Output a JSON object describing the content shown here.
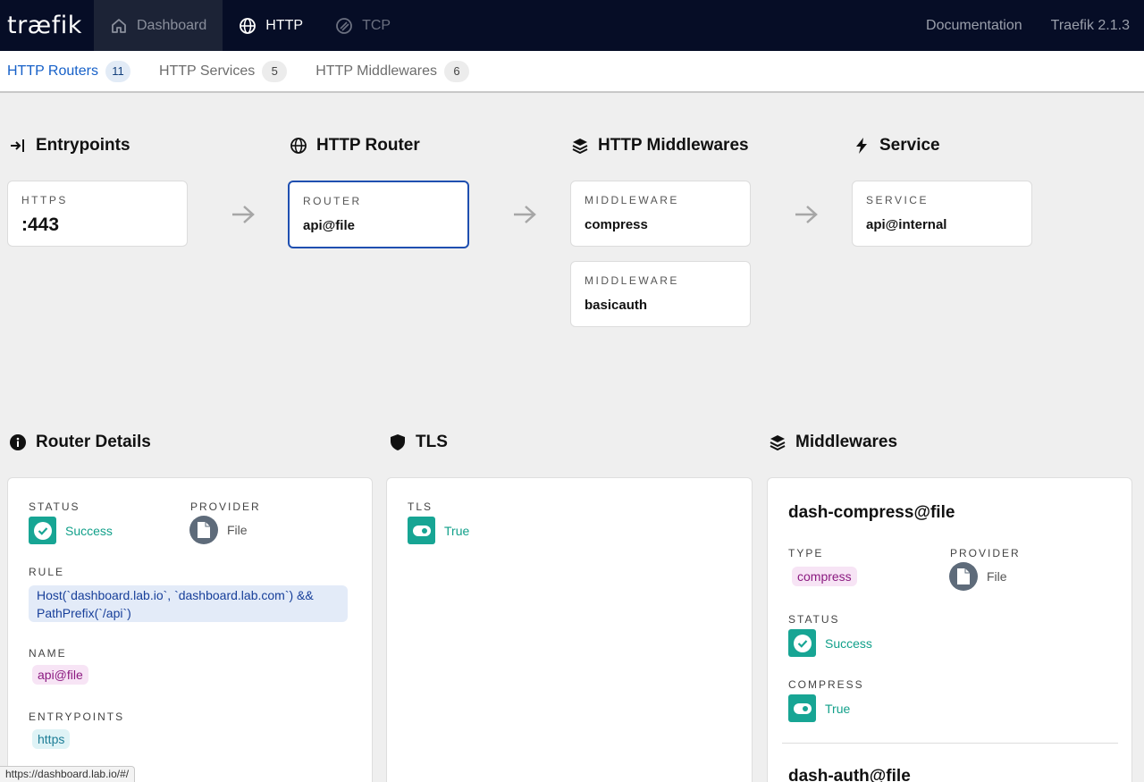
{
  "app": {
    "logo": "træfik"
  },
  "topnav": {
    "dashboard_label": "Dashboard",
    "http_label": "HTTP",
    "tcp_label": "TCP",
    "documentation_label": "Documentation",
    "version_label": "Traefik 2.1.3"
  },
  "subtabs": [
    {
      "label": "HTTP Routers",
      "count": "11"
    },
    {
      "label": "HTTP Services",
      "count": "5"
    },
    {
      "label": "HTTP Middlewares",
      "count": "6"
    }
  ],
  "flow": {
    "entrypoints": {
      "title": "Entrypoints",
      "label": "HTTPS",
      "value": ":443"
    },
    "router": {
      "title": "HTTP Router",
      "label": "ROUTER",
      "value": "api@file"
    },
    "middlewares": {
      "title": "HTTP Middlewares",
      "items": [
        {
          "label": "MIDDLEWARE",
          "value": "compress"
        },
        {
          "label": "MIDDLEWARE",
          "value": "basicauth"
        }
      ]
    },
    "service": {
      "title": "Service",
      "label": "SERVICE",
      "value": "api@internal"
    }
  },
  "router_details": {
    "title": "Router Details",
    "status_label": "STATUS",
    "status_value": "Success",
    "provider_label": "PROVIDER",
    "provider_value": "File",
    "rule_label": "RULE",
    "rule_line1": "Host(`dashboard.lab.io`, `dashboard.lab.com`) &&",
    "rule_line2": "PathPrefix(`/api`)",
    "name_label": "NAME",
    "name_value": "api@file",
    "entrypoints_label": "ENTRYPOINTS",
    "entrypoints_value": "https"
  },
  "tls": {
    "title": "TLS",
    "tls_label": "TLS",
    "tls_value": "True"
  },
  "middlewares_panel": {
    "title": "Middlewares",
    "items": [
      {
        "name": "dash-compress@file",
        "type_label": "TYPE",
        "type_value": "compress",
        "provider_label": "PROVIDER",
        "provider_value": "File",
        "status_label": "STATUS",
        "status_value": "Success",
        "compress_label": "COMPRESS",
        "compress_value": "True"
      },
      {
        "name": "dash-auth@file"
      }
    ]
  },
  "statusbar": {
    "url": "https://dashboard.lab.io/#/"
  },
  "colors": {
    "nav_bg": "#060d26",
    "accent_blue": "#1660c8",
    "teal": "#17a594",
    "purple_chip": "#8b1a80"
  }
}
